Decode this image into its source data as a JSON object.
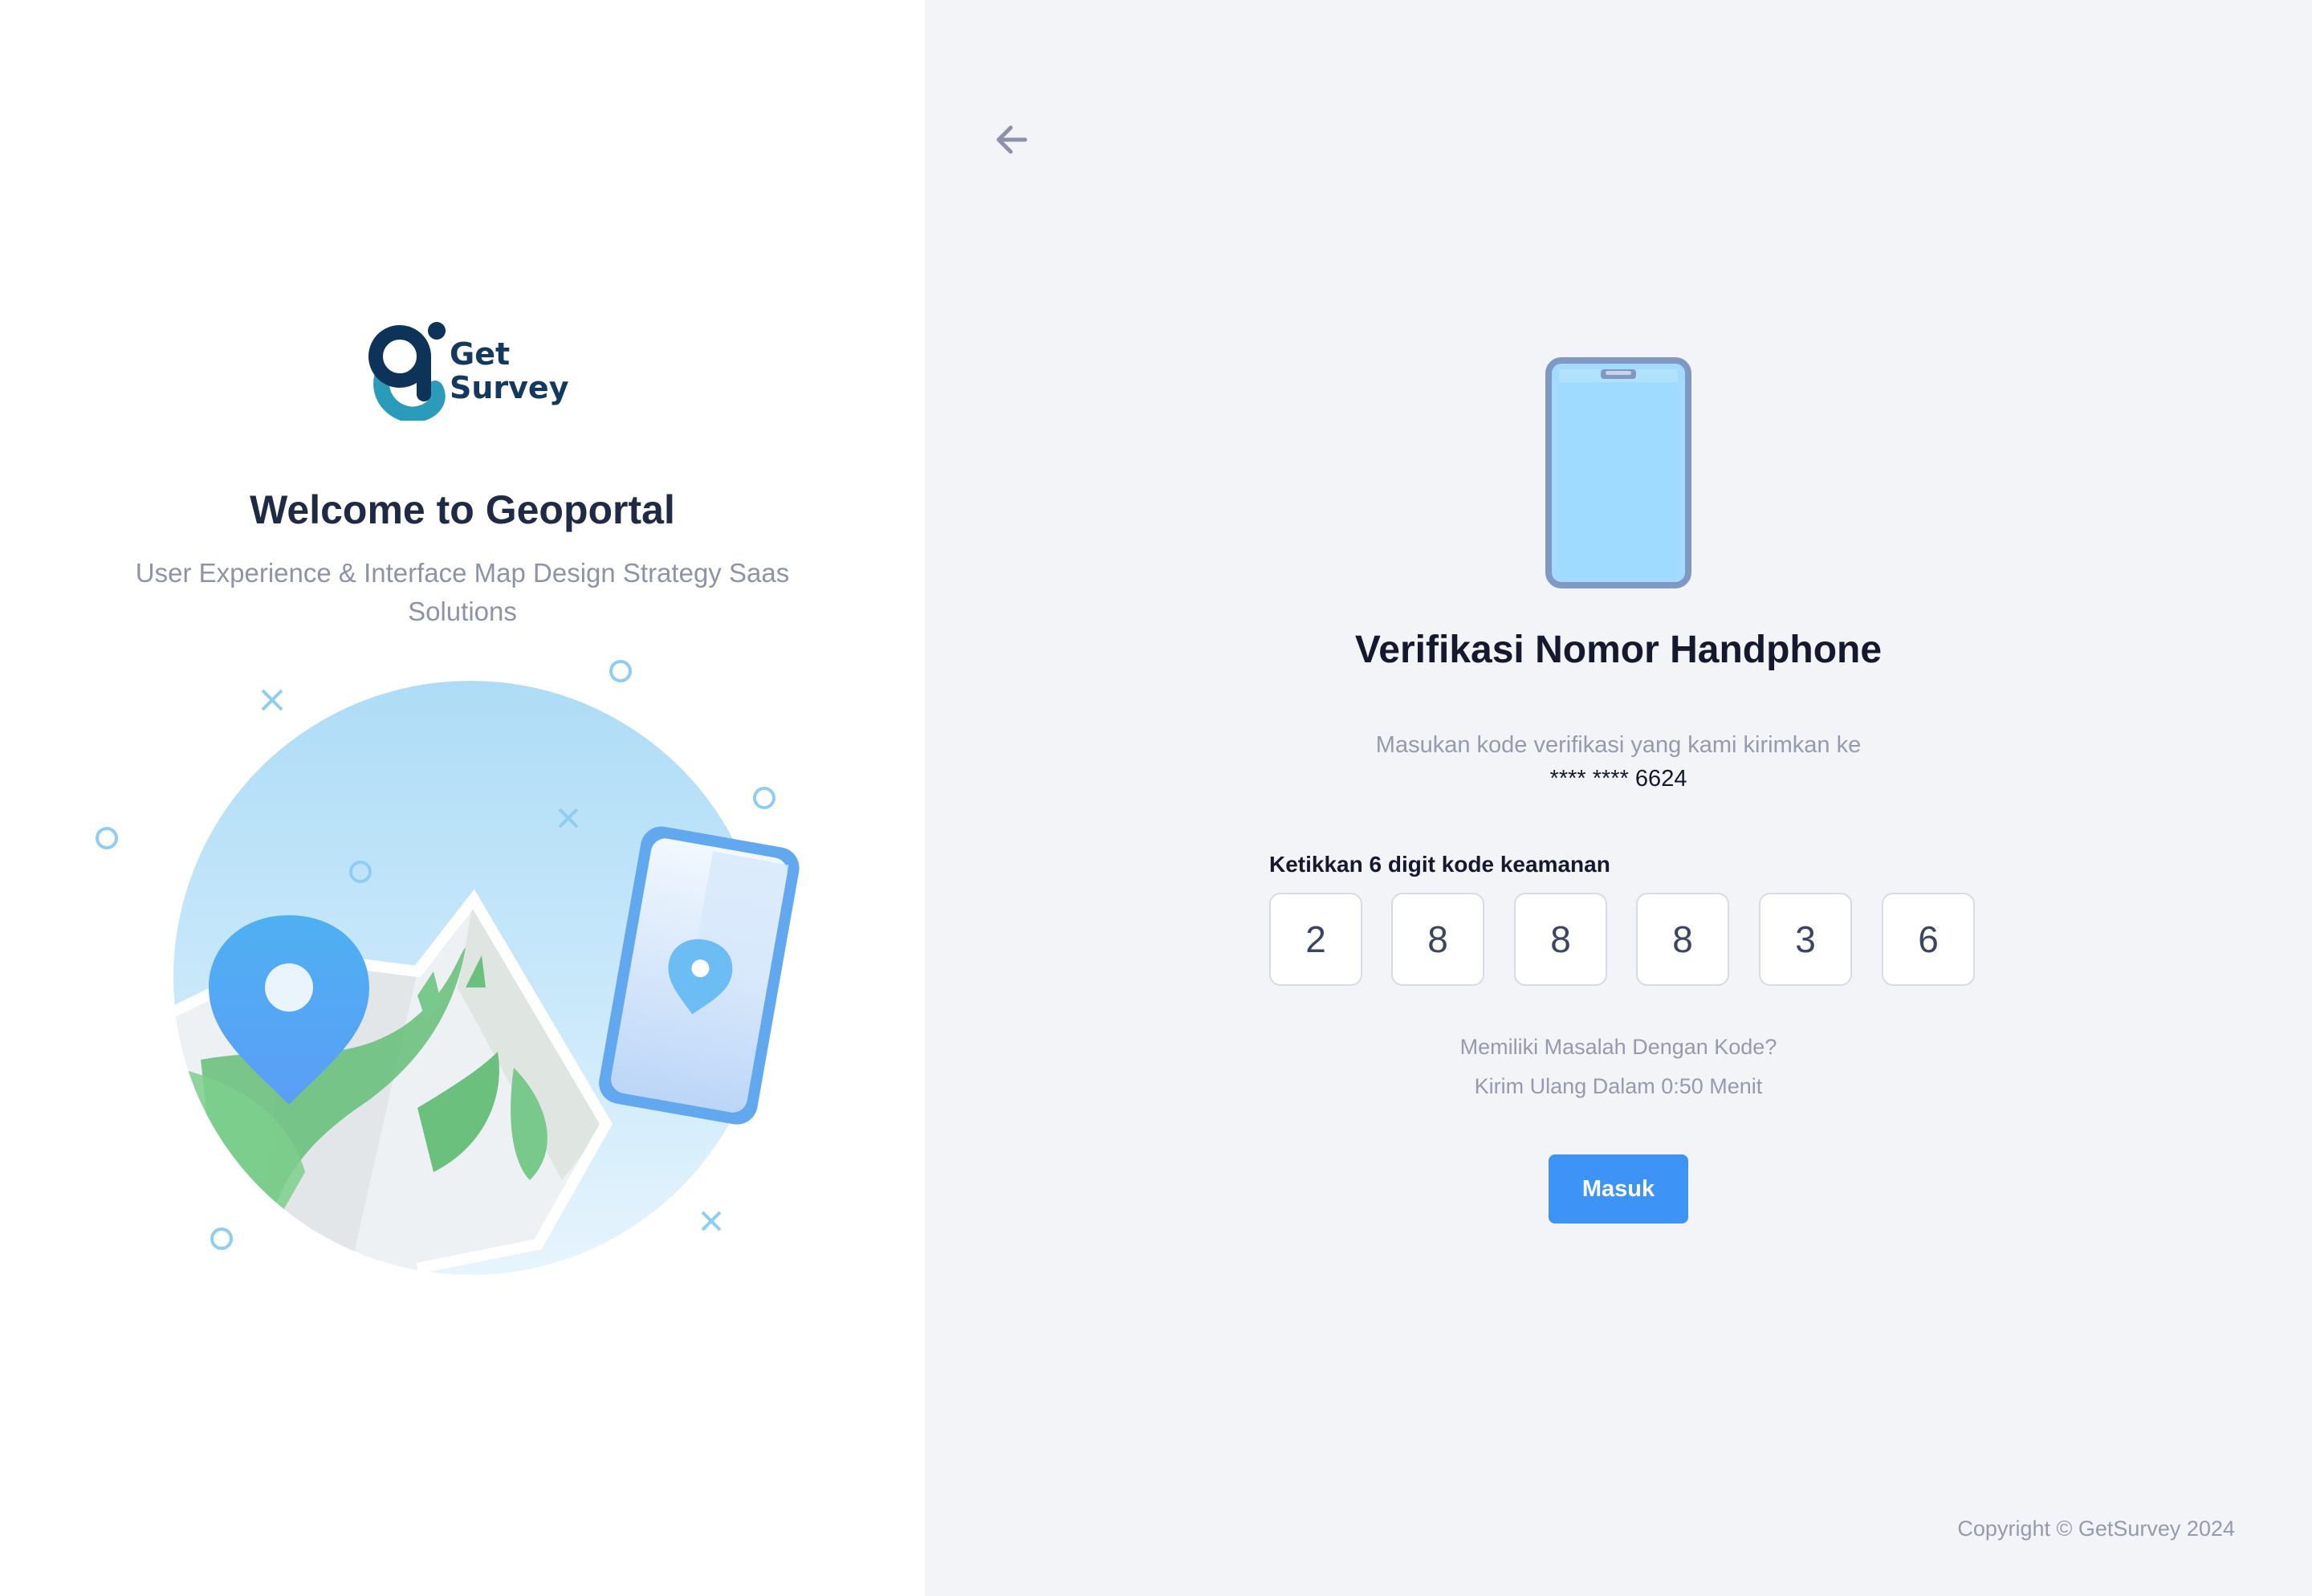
{
  "brand": {
    "logo_line1": "Get",
    "logo_line2": "Survey",
    "logo_colors": {
      "dark": "#0d3358",
      "teal": "#2a9bb8"
    }
  },
  "left_panel": {
    "heading": "Welcome to Geoportal",
    "tagline": "User Experience & Interface Map Design Strategy Saas Solutions",
    "illustration": "map-with-location-pin-and-phone-illustration"
  },
  "verification": {
    "back_icon": "arrow-left-icon",
    "phone_icon": "smartphone-icon",
    "title": "Verifikasi Nomor Handphone",
    "subtitle": "Masukan kode verifikasi yang kami kirimkan ke",
    "masked_phone": "**** **** 6624",
    "code_label": "Ketikkan 6 digit kode keamanan",
    "code_digits": [
      "2",
      "8",
      "8",
      "8",
      "3",
      "6"
    ],
    "issue_text": "Memiliki Masalah Dengan Kode?",
    "resend_text": "Kirim Ulang Dalam 0:50 Menit",
    "submit_label": "Masuk"
  },
  "footer": {
    "copyright": "Copyright © GetSurvey 2024"
  },
  "colors": {
    "primary": "#3d93f6",
    "panel_bg": "#f3f4f8",
    "heading": "#14192e",
    "muted": "#959aae"
  }
}
